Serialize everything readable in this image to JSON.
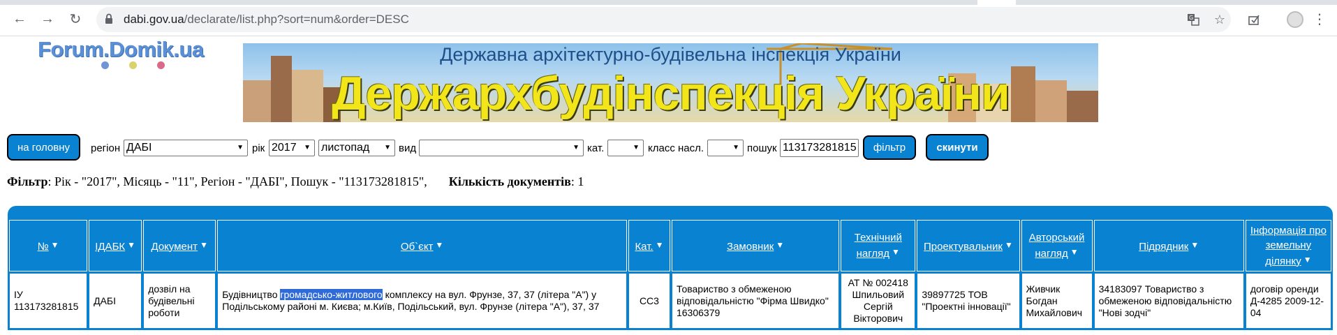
{
  "browser": {
    "url_host": "dabi.gov.ua",
    "url_path": "/declarate/list.php?sort=num&order=DESC"
  },
  "logo": {
    "text": "Forum.Domik.ua"
  },
  "banner": {
    "subtitle": "Державна архітектурно-будівельна інспекція України",
    "title": "Держархбудінспекція України"
  },
  "filter_bar": {
    "home_button": "на головну",
    "region_label": "регіон",
    "region_value": "ДАБІ",
    "year_label": "рік",
    "year_value": "2017",
    "month_value": "листопад",
    "type_label": "вид",
    "type_value": "",
    "cat_label": "кат.",
    "cat_value": "",
    "class_label": "класс насл.",
    "class_value": "",
    "search_label": "пошук",
    "search_value": "113173281815",
    "filter_button": "фільтр",
    "reset_button": "скинути"
  },
  "summary": {
    "filter_label": "Фільтр",
    "filter_text": ": Рік - \"2017\", Місяць - \"11\", Регіон - \"ДАБІ\", Пошук - \"113173281815\",",
    "count_label": "Кількість документів",
    "count_value": ": 1"
  },
  "table": {
    "headers": [
      "№",
      "ІДАБК",
      "Документ",
      "Об`єкт",
      "Кат.",
      "Замовник",
      "Технічний нагляд",
      "Проектувальник",
      "Авторський нагляд",
      "Підрядник",
      "Інформація про земельну ділянку"
    ],
    "row": {
      "num": "ІУ 113173281815",
      "idabk": "ДАБІ",
      "document": "дозвіл на будівельні роботи",
      "object_pre": "Будівництво ",
      "object_highlight": "громадсько-житлового",
      "object_post": " комплексу на вул. Фрунзе, 37, 37 (літера \"А\") у Подільському районі м. Києва; м.Київ, Подільський, вул. Фрунзе (літера \"А\"), 37, 37",
      "category": "СС3",
      "customer": "Товариство з обмеженою відповідальністю \"Фірма Швидко\" 16306379",
      "tech_supervision": "АТ № 002418 Шпильовий Сергій Вікторович",
      "designer": "39897725 ТОВ \"Проектні інновації\"",
      "author_supervision": "Живчик Богдан Михайлович",
      "contractor": "34183097 Товариство з обмеженою відповідальністю \"Нові зодчі\"",
      "land_info": "договір оренди Д-4285 2009-12-04"
    }
  }
}
